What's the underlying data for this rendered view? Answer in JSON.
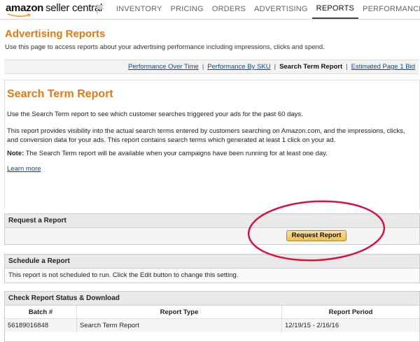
{
  "header": {
    "logo_brand": "amazon",
    "logo_rest": "seller central",
    "nav": [
      "INVENTORY",
      "PRICING",
      "ORDERS",
      "ADVERTISING",
      "REPORTS",
      "PERFORMANCE"
    ],
    "active_nav": "REPORTS"
  },
  "page": {
    "title": "Advertising Reports",
    "description": "Use this page to access reports about your advertising performance including impressions, clicks and spend."
  },
  "subnav": {
    "links": [
      "Performance Over Time",
      "Performance By SKU",
      "Search Term Report",
      "Estimated Page 1 Bid"
    ],
    "current": "Search Term Report"
  },
  "report": {
    "title": "Search Term Report",
    "p1": "Use the Search Term report to see which customer searches triggered your ads for the past 60 days.",
    "p2": "This report provides visibility into the actual search terms entered by customers searching on Amazon.com, and the impressions, clicks, and conversion data for your ads. This report contains search terms which generated at least 1 click on your ad.",
    "note_label": "Note:",
    "note_text": " The Search Term report will be available when your campaigns have been running for at least one day.",
    "learn_more": "Learn more"
  },
  "request": {
    "heading": "Request a Report",
    "button": "Request Report"
  },
  "schedule": {
    "heading": "Schedule a Report",
    "text": "This report is not scheduled to run. Click the Edit button to change this setting."
  },
  "status": {
    "heading": "Check Report Status & Download",
    "columns": [
      "Batch #",
      "Report Type",
      "Report Period"
    ],
    "rows": [
      [
        "56189016848",
        "Search Term Report",
        "12/19/15 - 2/16/16"
      ]
    ]
  },
  "colors": {
    "accent": "#e47911",
    "link": "#004b91",
    "annotation": "#d4143c"
  }
}
